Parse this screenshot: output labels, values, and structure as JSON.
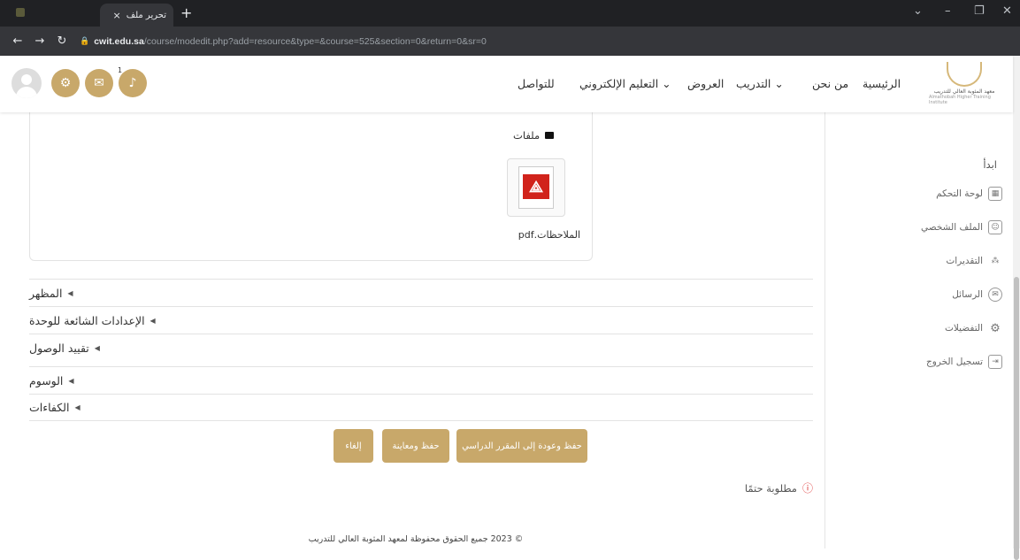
{
  "browser": {
    "tab_title": "تحرير ملف",
    "tab_close": "×",
    "new_tab": "+",
    "url_host": "cwit.edu.sa",
    "url_path": "/course/modedit.php?add=resource&type=&course=525&section=0&return=0&sr=0",
    "window_controls": [
      "⌄",
      "–",
      "❐",
      "✕"
    ]
  },
  "header": {
    "nav": [
      "الرئيسية",
      "من نحن",
      "التدريب ⌄",
      "العروض",
      "التعليم الإلكتروني ⌄",
      "للتواصل"
    ],
    "logo_text": "معهد المثوبة العالي للتدريب",
    "logo_sub": "Almathobah Higher Training Institute",
    "notification_count": "1"
  },
  "sidebar": {
    "title": "ابدأ",
    "items": [
      {
        "label": "لوحة التحكم",
        "icon": "dashboard-icon"
      },
      {
        "label": "الملف الشخصي",
        "icon": "profile-icon"
      },
      {
        "label": "التقديرات",
        "icon": "grades-icon"
      },
      {
        "label": "الرسائل",
        "icon": "messages-icon"
      },
      {
        "label": "التفضيلات",
        "icon": "preferences-icon"
      },
      {
        "label": "تسجيل الخروج",
        "icon": "logout-icon"
      }
    ]
  },
  "file_area": {
    "folder_label": "ملفات",
    "file_name": "الملاحظات.pdf"
  },
  "sections": [
    "المظهر",
    "الإعدادات الشائعة للوحدة",
    "تقييد الوصول",
    "الوسوم",
    "الكفاءات"
  ],
  "actions": {
    "save_return": "حفظ وعودة إلى المقرر الدراسي",
    "save_display": "حفظ ومعاينة",
    "cancel": "إلغاء"
  },
  "required_note": "مطلوبة حتمًا",
  "footer": "© 2023 جميع الحقوق محفوظة لمعهد المثوبة العالي للتدريب",
  "colors": {
    "accent": "#c8a86a",
    "chrome_dark": "#202124",
    "required": "#dd3333"
  }
}
